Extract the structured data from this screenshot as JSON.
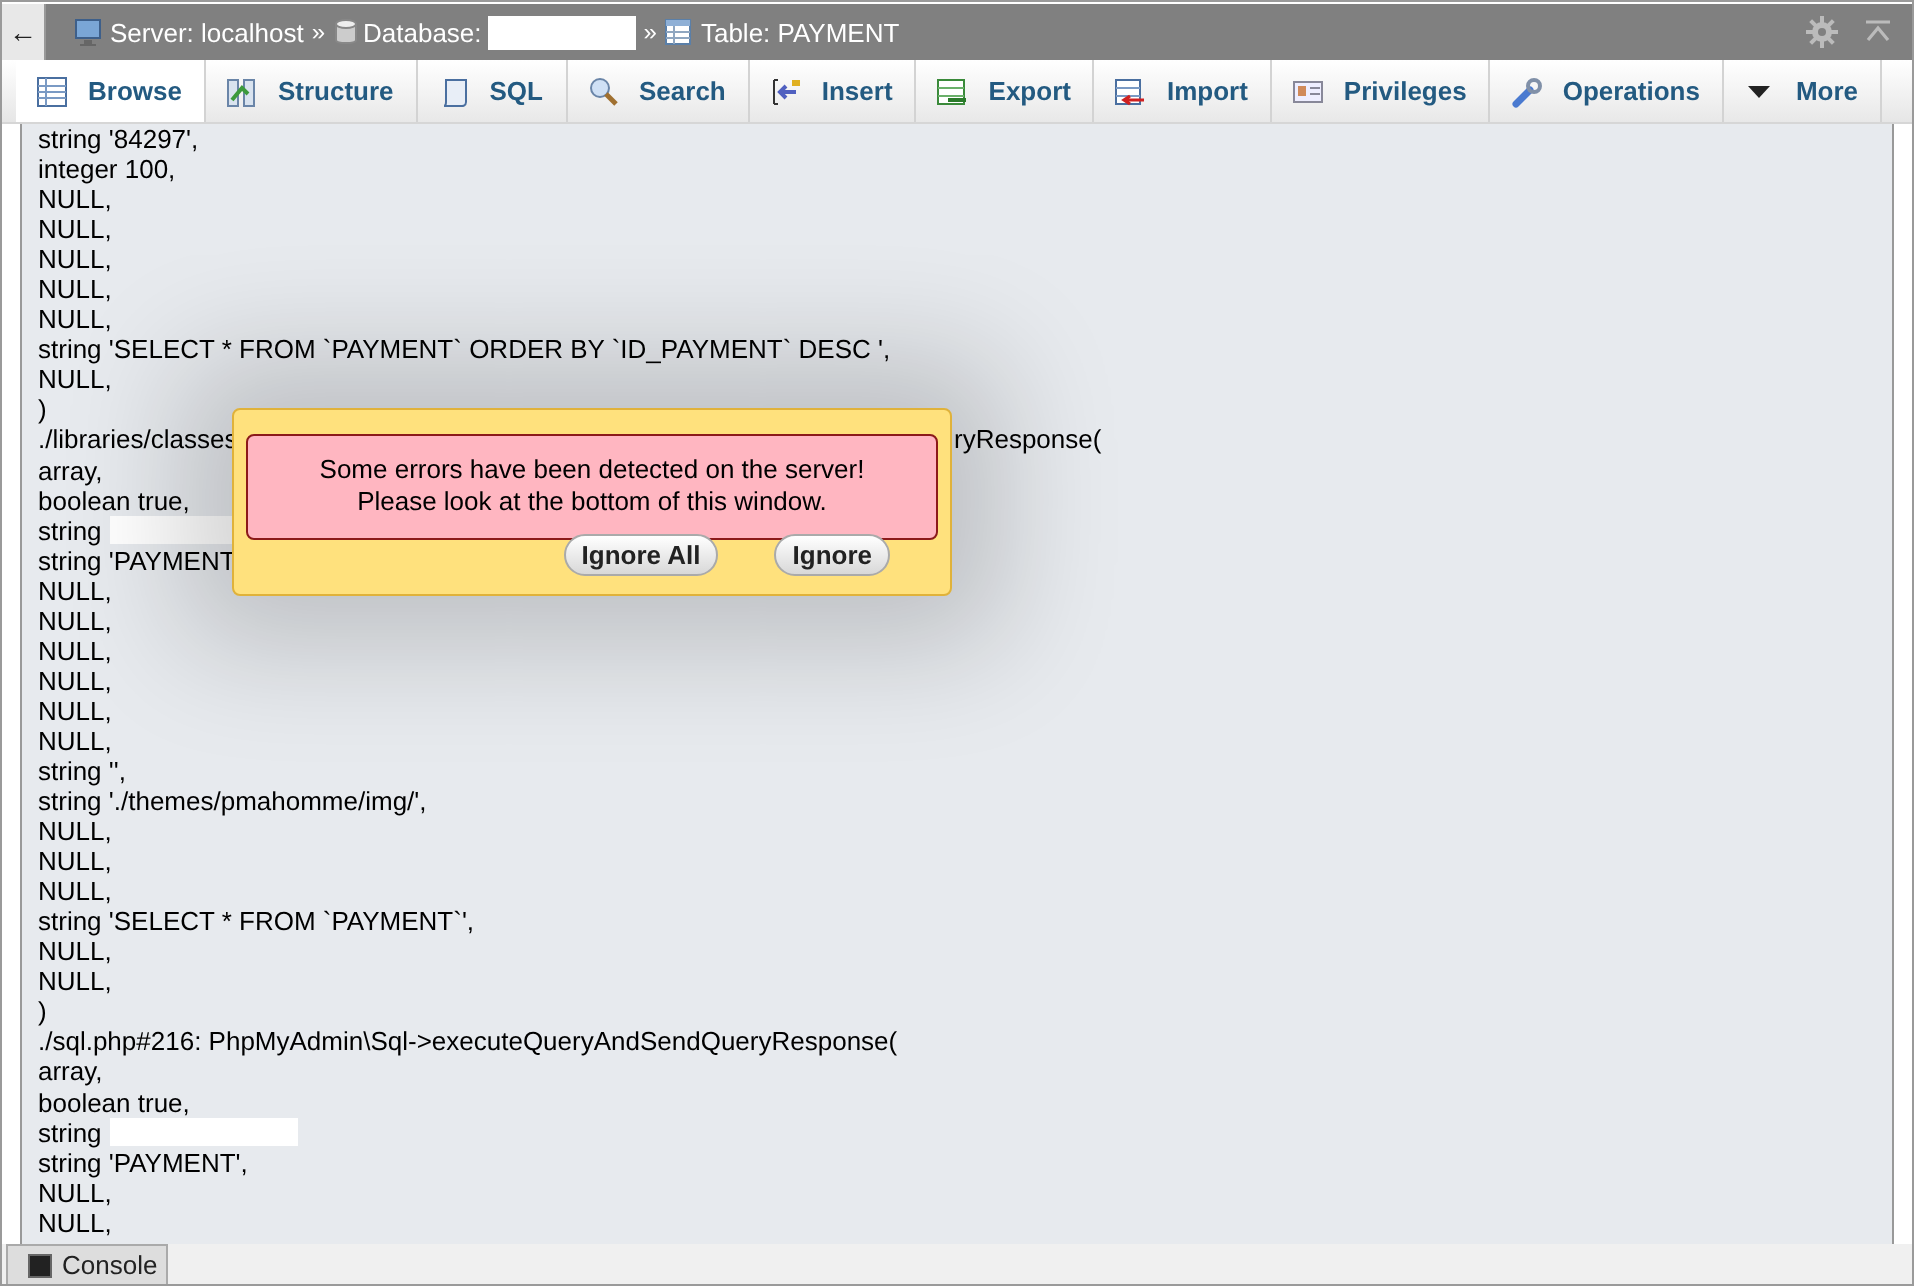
{
  "topbar": {
    "back": "←",
    "crumbs": [
      {
        "kind": "server",
        "label": "Server: localhost",
        "sep": "»"
      },
      {
        "kind": "database",
        "label": "Database:",
        "sep": "»",
        "redacted": true
      },
      {
        "kind": "table",
        "label": "Table: PAYMENT"
      }
    ]
  },
  "tabs": [
    {
      "kind": "browse",
      "label": "Browse",
      "selected": true
    },
    {
      "kind": "structure",
      "label": "Structure",
      "selected": false
    },
    {
      "kind": "sql",
      "label": "SQL",
      "selected": false
    },
    {
      "kind": "search",
      "label": "Search",
      "selected": false
    },
    {
      "kind": "insert",
      "label": "Insert",
      "selected": false
    },
    {
      "kind": "export",
      "label": "Export",
      "selected": false
    },
    {
      "kind": "import",
      "label": "Import",
      "selected": false
    },
    {
      "kind": "privileges",
      "label": "Privileges",
      "selected": false
    },
    {
      "kind": "operations",
      "label": "Operations",
      "selected": false
    },
    {
      "kind": "more",
      "label": "More",
      "selected": false
    }
  ],
  "log_lines": [
    {
      "text": "string '84297',"
    },
    {
      "text": "integer 100,"
    },
    {
      "text": "NULL,"
    },
    {
      "text": "NULL,"
    },
    {
      "text": "NULL,"
    },
    {
      "text": "NULL,"
    },
    {
      "text": "NULL,"
    },
    {
      "text": "string 'SELECT * FROM `PAYMENT` ORDER BY `ID_PAYMENT` DESC ',"
    },
    {
      "text": "NULL,"
    },
    {
      "text": ")"
    },
    {
      "text": "./libraries/classes",
      "tail": "ryResponse("
    },
    {
      "text": "array,"
    },
    {
      "text": "boolean true,"
    },
    {
      "text": "string",
      "redacted": true
    },
    {
      "text": "string 'PAYMENT"
    },
    {
      "text": "NULL,"
    },
    {
      "text": "NULL,"
    },
    {
      "text": "NULL,"
    },
    {
      "text": "NULL,"
    },
    {
      "text": "NULL,"
    },
    {
      "text": "NULL,"
    },
    {
      "text": "string '',"
    },
    {
      "text": "string './themes/pmahomme/img/',"
    },
    {
      "text": "NULL,"
    },
    {
      "text": "NULL,"
    },
    {
      "text": "NULL,"
    },
    {
      "text": "string 'SELECT * FROM `PAYMENT`',"
    },
    {
      "text": "NULL,"
    },
    {
      "text": "NULL,"
    },
    {
      "text": ")"
    },
    {
      "text": "./sql.php#216: PhpMyAdmin\\Sql->executeQueryAndSendQueryResponse("
    },
    {
      "text": "array,"
    },
    {
      "text": "boolean true,"
    },
    {
      "text": "string",
      "redacted": true
    },
    {
      "text": "string 'PAYMENT',"
    },
    {
      "text": "NULL,"
    },
    {
      "text": "NULL,"
    }
  ],
  "error_dialog": {
    "message": [
      "Some errors have been detected on the server!",
      "Please look at the bottom of this window."
    ],
    "buttons": [
      "Ignore All",
      "Ignore"
    ]
  },
  "console": {
    "label": "Console"
  }
}
